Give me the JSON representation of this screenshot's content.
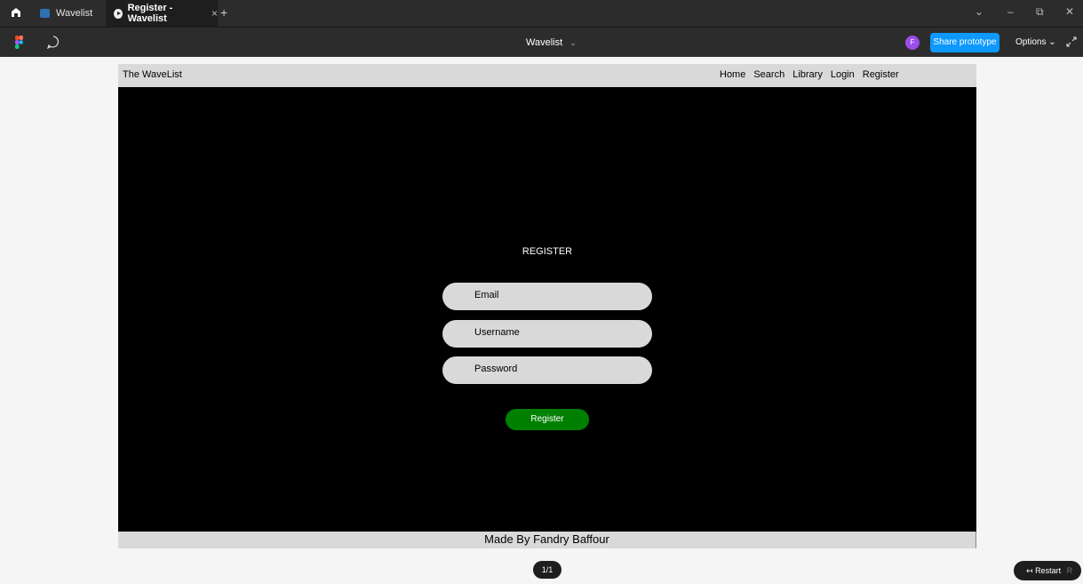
{
  "tabs": [
    {
      "label": "Wavelist"
    },
    {
      "label": "Register - Wavelist",
      "close": "×"
    }
  ],
  "new_tab": "+",
  "window_controls": {
    "dropdown": "⌄",
    "minimize": "–",
    "restore": "⧉",
    "close": "✕"
  },
  "toolbar": {
    "file_title": "Wavelist",
    "file_chevron": "⌄",
    "avatar_initial": "F",
    "share_label": "Share prototype",
    "options_label": "Options ⌄"
  },
  "site": {
    "brand": "The WaveList",
    "nav": [
      "Home",
      "Search",
      "Library",
      "Login",
      "Register"
    ],
    "heading": "REGISTER",
    "fields": [
      "Email",
      "Username",
      "Password"
    ],
    "button": "Register",
    "footer": "Made By Fandry Baffour"
  },
  "prototype": {
    "page_indicator": "1/1",
    "restart_label": "Restart",
    "restart_key": "R"
  },
  "colors": {
    "chrome": "#2c2c2c",
    "share_blue": "#0d99ff",
    "site_main": "#000000",
    "site_bars": "#d9d9d9",
    "register_green": "#008000",
    "avatar_purple": "#9b4de8"
  }
}
